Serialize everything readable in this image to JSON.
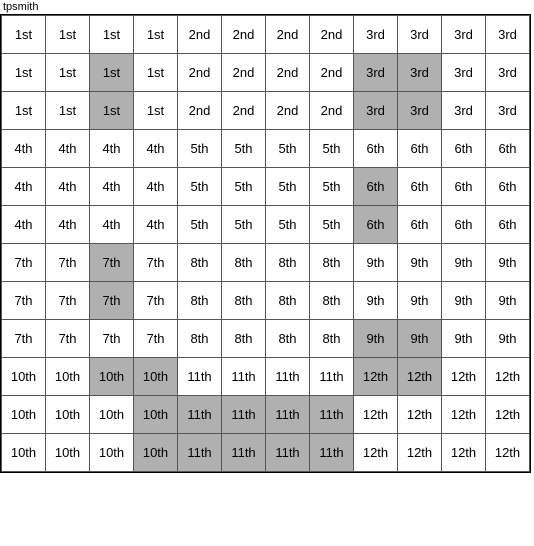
{
  "title": "tpsmith",
  "grid": {
    "rows": [
      [
        "1st",
        "1st",
        "1st",
        "1st",
        "2nd",
        "2nd",
        "2nd",
        "2nd",
        "3rd",
        "3rd",
        "3rd",
        "3rd"
      ],
      [
        "1st",
        "1st",
        "1st",
        "1st",
        "2nd",
        "2nd",
        "2nd",
        "2nd",
        "3rd",
        "3rd",
        "3rd",
        "3rd"
      ],
      [
        "1st",
        "1st",
        "1st",
        "1st",
        "2nd",
        "2nd",
        "2nd",
        "2nd",
        "3rd",
        "3rd",
        "3rd",
        "3rd"
      ],
      [
        "4th",
        "4th",
        "4th",
        "4th",
        "5th",
        "5th",
        "5th",
        "5th",
        "6th",
        "6th",
        "6th",
        "6th"
      ],
      [
        "4th",
        "4th",
        "4th",
        "4th",
        "5th",
        "5th",
        "5th",
        "5th",
        "6th",
        "6th",
        "6th",
        "6th"
      ],
      [
        "4th",
        "4th",
        "4th",
        "4th",
        "5th",
        "5th",
        "5th",
        "5th",
        "6th",
        "6th",
        "6th",
        "6th"
      ],
      [
        "7th",
        "7th",
        "7th",
        "7th",
        "8th",
        "8th",
        "8th",
        "8th",
        "9th",
        "9th",
        "9th",
        "9th"
      ],
      [
        "7th",
        "7th",
        "7th",
        "7th",
        "8th",
        "8th",
        "8th",
        "8th",
        "9th",
        "9th",
        "9th",
        "9th"
      ],
      [
        "7th",
        "7th",
        "7th",
        "7th",
        "8th",
        "8th",
        "8th",
        "8th",
        "9th",
        "9th",
        "9th",
        "9th"
      ],
      [
        "10th",
        "10th",
        "10th",
        "10th",
        "11th",
        "11th",
        "11th",
        "11th",
        "12th",
        "12th",
        "12th",
        "12th"
      ],
      [
        "10th",
        "10th",
        "10th",
        "10th",
        "11th",
        "11th",
        "11th",
        "11th",
        "12th",
        "12th",
        "12th",
        "12th"
      ],
      [
        "10th",
        "10th",
        "10th",
        "10th",
        "11th",
        "11th",
        "11th",
        "11th",
        "12th",
        "12th",
        "12th",
        "12th"
      ]
    ],
    "highlights": [
      [
        2,
        2
      ],
      [
        1,
        2
      ],
      [
        1,
        8
      ],
      [
        1,
        9
      ],
      [
        2,
        8
      ],
      [
        2,
        9
      ],
      [
        5,
        8
      ],
      [
        4,
        8
      ],
      [
        6,
        2
      ],
      [
        7,
        2
      ],
      [
        8,
        8
      ],
      [
        8,
        9
      ],
      [
        9,
        2
      ],
      [
        9,
        3
      ],
      [
        10,
        3
      ],
      [
        11,
        3
      ],
      [
        9,
        8
      ],
      [
        9,
        9
      ],
      [
        10,
        4
      ],
      [
        10,
        5
      ],
      [
        10,
        6
      ],
      [
        10,
        7
      ],
      [
        11,
        4
      ],
      [
        11,
        5
      ],
      [
        11,
        6
      ],
      [
        11,
        7
      ]
    ]
  }
}
